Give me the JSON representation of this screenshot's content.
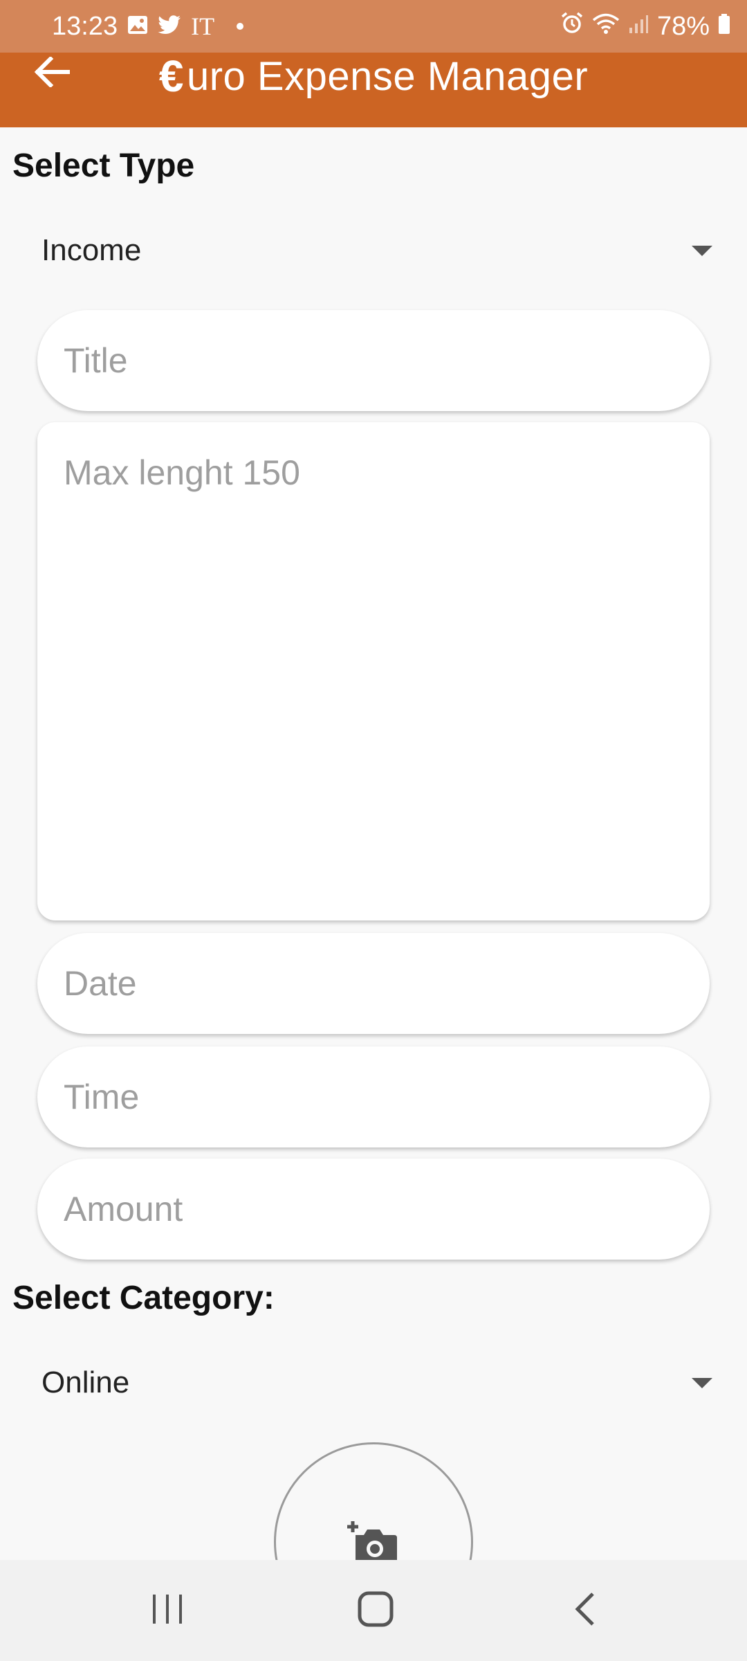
{
  "status_bar": {
    "time": "13:23",
    "carrier_text": "IT",
    "battery": "78%",
    "icons": [
      "image-icon",
      "twitter-icon",
      "alarm-icon",
      "wifi-icon",
      "signal-icon",
      "battery-icon"
    ]
  },
  "app_bar": {
    "title_euro": "€",
    "title_rest": "uro Expense Manager",
    "back_icon": "arrow-left-icon"
  },
  "form": {
    "type_label": "Select Type",
    "type_selected": "Income",
    "title_placeholder": "Title",
    "description_placeholder": "Max lenght 150",
    "date_placeholder": "Date",
    "time_placeholder": "Time",
    "amount_placeholder": "Amount",
    "category_label": "Select Category:",
    "category_selected": "Online",
    "photo_icon": "add-photo-icon"
  },
  "nav_bar": {
    "buttons": [
      "recents-icon",
      "home-icon",
      "back-icon"
    ]
  },
  "colors": {
    "status_bar": "#d48659",
    "app_bar": "#cc6423",
    "background": "#f8f8f8",
    "field": "#ffffff",
    "placeholder": "#9e9e9e"
  }
}
